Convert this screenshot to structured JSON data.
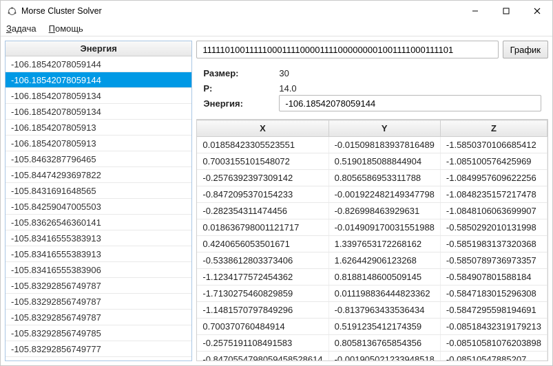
{
  "window": {
    "title": "Morse Cluster Solver"
  },
  "menu": {
    "task": "Задача",
    "help": "Помощь"
  },
  "left": {
    "header": "Энергия",
    "items": [
      "-106.18542078059144",
      "-106.18542078059144",
      "-106.18542078059134",
      "-106.18542078059134",
      "-106.1854207805913",
      "-106.1854207805913",
      "-105.8463287796465",
      "-105.84474293697822",
      "-105.8431691648565",
      "-105.84259047005503",
      "-105.83626546360141",
      "-105.83416555383913",
      "-105.83416555383913",
      "-105.83416555383906",
      "-105.83292856749787",
      "-105.83292856749787",
      "-105.83292856749787",
      "-105.83292856749785",
      "-105.83292856749777"
    ],
    "selected_index": 1
  },
  "right": {
    "bitstring": "11111010011111000111100001111000000001001111000111101",
    "graph_btn": "График",
    "size_label": "Размер:",
    "size_value": "30",
    "p_label": "P:",
    "p_value": "14.0",
    "energy_label": "Энергия:",
    "energy_value": "-106.18542078059144",
    "columns": [
      "X",
      "Y",
      "Z"
    ],
    "rows": [
      [
        "0.01858423305523551",
        "-0.015098183937816489",
        "-1.5850370106685412"
      ],
      [
        "0.7003155101548072",
        "0.5190185088844904",
        "-1.085100576425969"
      ],
      [
        "-0.2576392397309142",
        "0.8056586953311788",
        "-1.0849957609622256"
      ],
      [
        "-0.8472095370154233",
        "-0.001922482149347798",
        "-1.0848235157217478"
      ],
      [
        "-0.282354311474456",
        "-0.826998463929631",
        "-1.0848106063699907"
      ],
      [
        "0.018636798001121717",
        "-0.014909170031551988",
        "-0.5850292010131998"
      ],
      [
        "0.4240656053501671",
        "1.3397653172268162",
        "-0.5851983137320368"
      ],
      [
        "-0.5338612803373406",
        "1.626442906123268",
        "-0.5850789736973357"
      ],
      [
        "-1.1234177572454362",
        "0.8188148600509145",
        "-0.584907801588184"
      ],
      [
        "-1.7130275460829859",
        "0.011198836444823362",
        "-0.5847183015296308"
      ],
      [
        "-1.1481570797849296",
        "-0.8137963433536434",
        "-0.5847295598194691"
      ],
      [
        "0.700370760484914",
        "0.5191235412174359",
        "-0.08518432319179213"
      ],
      [
        "-0.2575191108491583",
        "0.8058136765854356",
        "-0.08510581076203898"
      ],
      [
        "-0.8470554798059458528614",
        "-0.001905021233948518",
        "-0.08510547885207"
      ]
    ]
  }
}
